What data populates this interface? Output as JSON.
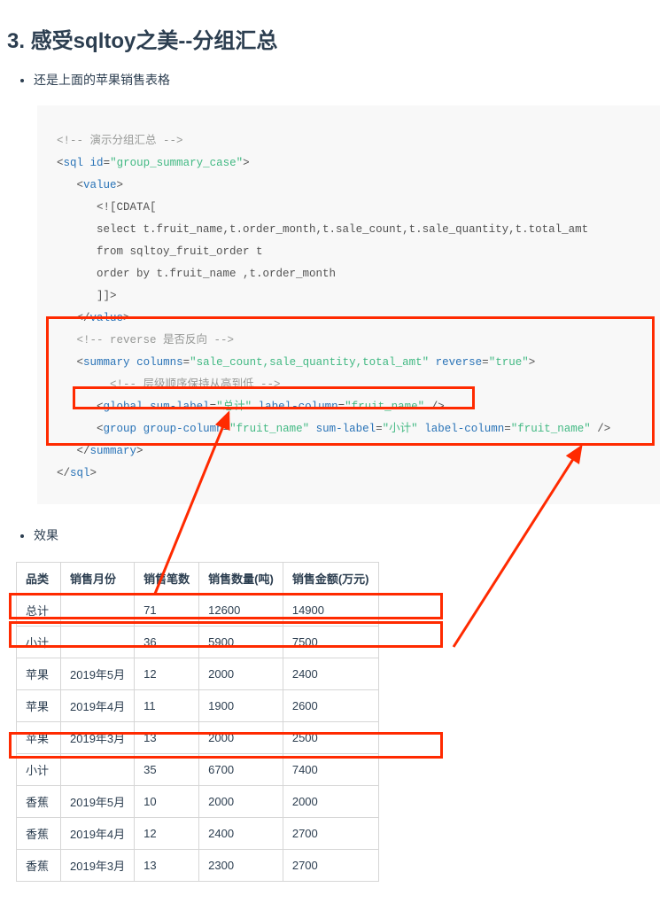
{
  "heading": "3. 感受sqltoy之美--分组汇总",
  "bullet_intro": "还是上面的苹果销售表格",
  "bullet_result": "效果",
  "code": {
    "c1": "<!-- 演示分组汇总 -->",
    "sql_tag": "sql",
    "sql_id_attr": "id",
    "sql_id_val": "\"group_summary_case\"",
    "value_tag": "value",
    "cdata_open": "<![CDATA[",
    "line_select": "select t.fruit_name,t.order_month,t.sale_count,t.sale_quantity,t.total_amt",
    "line_from": "from sqltoy_fruit_order t",
    "line_order": "order by t.fruit_name ,t.order_month",
    "cdata_close": "]]>",
    "c2": "<!-- reverse 是否反向 -->",
    "summary_tag": "summary",
    "cols_attr": "columns",
    "cols_val": "\"sale_count,sale_quantity,total_amt\"",
    "rev_attr": "reverse",
    "rev_val": "\"true\"",
    "c3": "<!-- 层级顺序保持从高到低 -->",
    "global_tag": "global",
    "sumlabel_attr": "sum-label",
    "sumlabel_total_val": "\"总计\"",
    "labelcol_attr": "label-column",
    "labelcol_val": "\"fruit_name\"",
    "group_tag": "group",
    "groupcol_attr": "group-column",
    "groupcol_val": "\"fruit_name\"",
    "sumlabel_sub_val": "\"小计\""
  },
  "table": {
    "headers": [
      "品类",
      "销售月份",
      "销售笔数",
      "销售数量(吨)",
      "销售金额(万元)"
    ],
    "rows": [
      [
        "总计",
        "",
        "71",
        "12600",
        "14900"
      ],
      [
        "小计",
        "",
        "36",
        "5900",
        "7500"
      ],
      [
        "苹果",
        "2019年5月",
        "12",
        "2000",
        "2400"
      ],
      [
        "苹果",
        "2019年4月",
        "11",
        "1900",
        "2600"
      ],
      [
        "苹果",
        "2019年3月",
        "13",
        "2000",
        "2500"
      ],
      [
        "小计",
        "",
        "35",
        "6700",
        "7400"
      ],
      [
        "香蕉",
        "2019年5月",
        "10",
        "2000",
        "2000"
      ],
      [
        "香蕉",
        "2019年4月",
        "12",
        "2400",
        "2700"
      ],
      [
        "香蕉",
        "2019年3月",
        "13",
        "2300",
        "2700"
      ]
    ]
  }
}
